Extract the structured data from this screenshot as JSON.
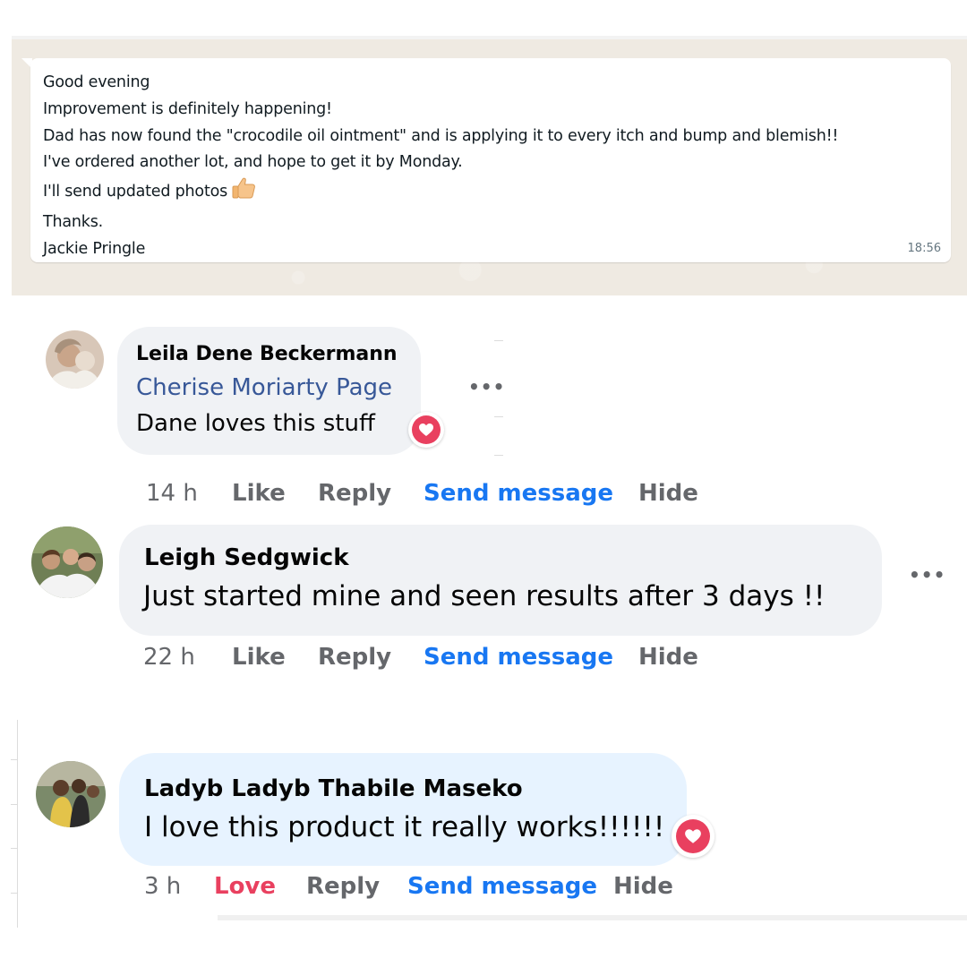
{
  "whatsapp": {
    "message_lines": [
      "Good evening",
      "Improvement is definitely happening!",
      "Dad has now found the \"crocodile oil ointment\" and is applying it to every itch and bump and blemish!!",
      "I've ordered another lot, and hope to get it by Monday.",
      "I'll send updated photos",
      "Thanks.",
      "Jackie Pringle"
    ],
    "emoji_icon": "thumbs-up-icon",
    "time": "18:56",
    "colors": {
      "wallpaper": "#efeae2",
      "bubble": "#ffffff"
    }
  },
  "comments": [
    {
      "author": "Leila Dene Beckermann",
      "mention": "Cherise Moriarty Page",
      "text": "Dane loves this stuff",
      "reaction_icon": "heart-reaction-icon",
      "time": "14 h",
      "actions": {
        "like": "Like",
        "reply": "Reply",
        "send": "Send message",
        "hide": "Hide"
      }
    },
    {
      "author": "Leigh Sedgwick",
      "text": "Just started mine and seen results after 3 days !!",
      "time": "22 h",
      "actions": {
        "like": "Like",
        "reply": "Reply",
        "send": "Send message",
        "hide": "Hide"
      }
    },
    {
      "author": "Ladyb Ladyb Thabile Maseko",
      "text": "I love this product it really works!!!!!!",
      "reaction_icon": "heart-reaction-icon",
      "time": "3 h",
      "actions": {
        "like": "Love",
        "reply": "Reply",
        "send": "Send message",
        "hide": "Hide"
      }
    }
  ],
  "more_icon": "•••",
  "colors": {
    "link": "#1877f2",
    "mention": "#385898",
    "love": "#e9405f",
    "bubble": "#f0f2f5",
    "bubble_highlight": "#e7f3ff"
  }
}
